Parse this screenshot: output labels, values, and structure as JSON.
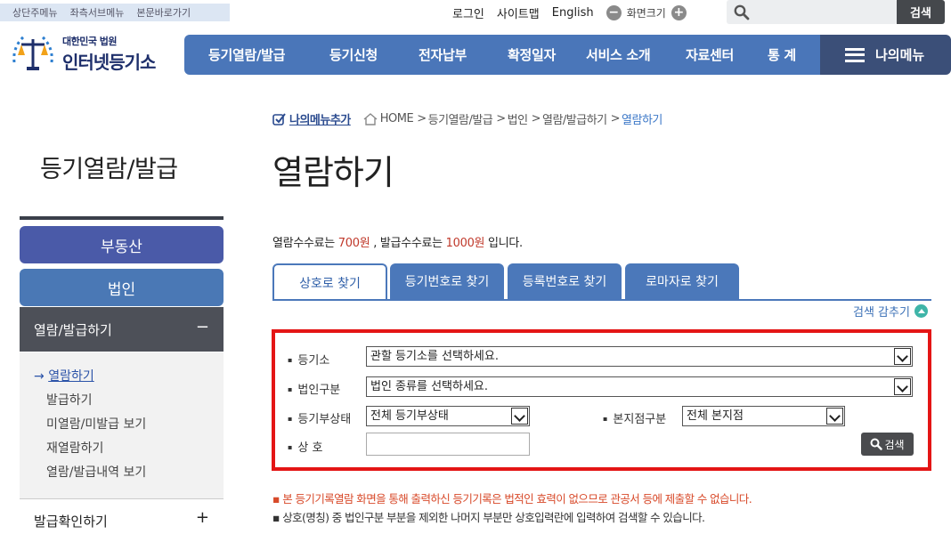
{
  "skipnav": [
    "상단주메뉴",
    "좌측서브메뉴",
    "본문바로가기"
  ],
  "util": {
    "login": "로그인",
    "sitemap": "사이트맵",
    "english": "English",
    "zoom_minus": "−",
    "zoom_label": "화면크기",
    "zoom_plus": "+",
    "search_button": "검색"
  },
  "logo": {
    "sub": "대한민국 법원",
    "main": "인터넷등기소"
  },
  "gnb": [
    "등기열람/발급",
    "등기신청",
    "전자납부",
    "확정일자",
    "서비스 소개",
    "자료센터",
    "통 계"
  ],
  "mymenu": "나의메뉴",
  "lnb": {
    "title": "등기열람/발급",
    "btn_realestate": "부동산",
    "btn_corp": "법인",
    "sub_title": "열람/발급하기",
    "sub_toggle": "−",
    "active_marker": "→",
    "items": [
      "열람하기",
      "발급하기",
      "미열람/미발급 보기",
      "재열람하기",
      "열람/발급내역 보기"
    ],
    "bottom": "발급확인하기",
    "bottom_toggle": "+"
  },
  "breadcrumb": {
    "add_my": "나의메뉴추가",
    "path": [
      "HOME",
      "등기열람/발급",
      "법인",
      "열람/발급하기"
    ],
    "current": "열람하기",
    "sep": ">"
  },
  "page_title": "열람하기",
  "fee": {
    "pre": "열람수수료는 ",
    "view_fee": "700원",
    "mid": " , 발급수수료는 ",
    "issue_fee": "1000원",
    "post": " 입니다."
  },
  "tabs": [
    "상호로 찾기",
    "등기번호로 찾기",
    "등록번호로 찾기",
    "로마자로 찾기"
  ],
  "hide_search": "검색 감추기",
  "form": {
    "registry_label": "등기소",
    "registry_value": "관할 등기소를 선택하세요.",
    "corp_type_label": "법인구분",
    "corp_type_value": "법인 종류를 선택하세요.",
    "status_label": "등기부상태",
    "status_value": "전체 등기부상태",
    "branch_label": "본지점구분",
    "branch_value": "전체 본지점",
    "name_label": "상 호",
    "name_value": "",
    "search_label": "검색"
  },
  "notes": [
    "▪ 본 등기기록열람 화면을 통해 출력하신 등기기록은 법적인 효력이 없으므로 관공서 등에 제출할 수 없습니다.",
    "▪ 상호(명칭) 중 법인구분 부분을 제외한 나머지 부분만 상호입력란에 입력하여 검색할 수 있습니다."
  ],
  "colors": {
    "gnb": "#4a76b9",
    "mymenu": "#3b4f78",
    "highlight_box": "#e41515",
    "fee_red": "#c0392b"
  }
}
